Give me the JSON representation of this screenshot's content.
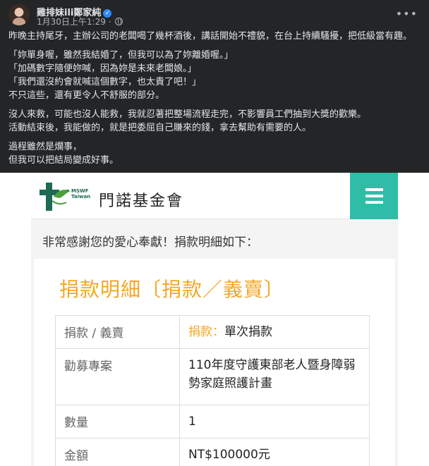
{
  "post": {
    "author": "雞排妹ili鄭家純",
    "timestamp": "1月30日上午1:29",
    "separator": "·",
    "paragraphs": [
      [
        "昨晚主持尾牙，主辦公司的老闆喝了幾杯酒後，講話開始不禮貌，在台上持續騷擾，把低級當有趣。"
      ],
      [
        "「妳單身喔，雖然我結婚了，但我可以為了妳離婚喔。」",
        "「加碼數字隨便妳喊，因為妳是未來老闆娘。」",
        "「我們還沒約會就喊這個數字，也太貴了吧！」",
        "不只這些，還有更令人不舒服的部分。"
      ],
      [
        "沒人來救，可能也沒人能救，我就忍著把整場流程走完，不影響員工們抽到大獎的歡樂。",
        "活動結束後，我能做的，就是把委屈自己賺來的錢，拿去幫助有需要的人。"
      ],
      [
        "過程雖然是爛事，",
        "但我可以把結局變成好事。"
      ]
    ]
  },
  "donation": {
    "logo_text": "MSWF",
    "logo_subtext": "Taiwan",
    "org_name": "門諾基金會",
    "thanks": "非常感謝您的愛心奉獻！捐款明細如下：",
    "title": "捐款明細〔捐款／義賣〕",
    "rows": [
      {
        "label": "捐款 / 義賣",
        "value_accent": "捐款：",
        "value": "單次捐款"
      },
      {
        "label": "勸募專案",
        "value_accent": "",
        "value": "110年度守護東部老人暨身障弱勢家庭照護計畫"
      },
      {
        "label": "數量",
        "value_accent": "",
        "value": "1"
      },
      {
        "label": "金額",
        "value_accent": "",
        "value": "NT$100000元"
      }
    ]
  },
  "colors": {
    "fb_bg": "#242526",
    "accent_orange": "#f5a623",
    "menu_teal": "#2fbda8"
  },
  "icons": [
    "verified-icon",
    "globe-icon",
    "more-icon",
    "menu-icon",
    "cross-dove-logo-icon"
  ]
}
